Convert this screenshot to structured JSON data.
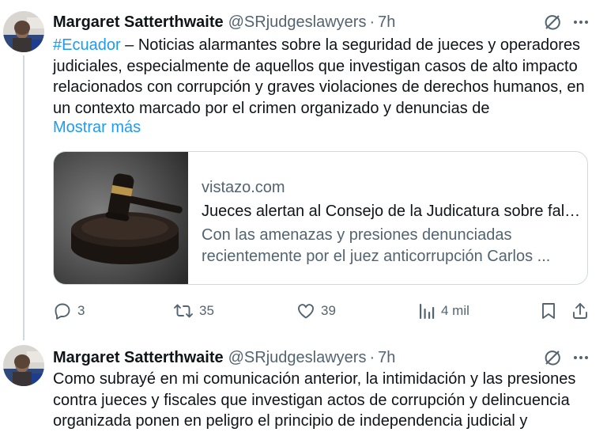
{
  "tweets": [
    {
      "author": "Margaret Satterthwaite",
      "handle": "@SRjudgeslawyers",
      "separator": "·",
      "time": "7h",
      "hashtag": "#Ecuador",
      "text": " – Noticias alarmantes sobre la seguridad de jueces y operadores judiciales, especialmente de aquellos que investigan casos de alto impacto relacionados con corrupción y graves violaciones de derechos humanos, en un contexto marcado por el crimen organizado y denuncias de",
      "show_more": "Mostrar más",
      "card": {
        "domain": "vistazo.com",
        "title": "Jueces alertan al Consejo de la Judicatura sobre falta de seguridad",
        "description_line1": "Con las amenazas y presiones denunciadas",
        "description_line2": "recientemente por el juez anticorrupción Carlos ..."
      },
      "actions": {
        "replies": "3",
        "reposts": "35",
        "likes": "39",
        "views": "4 mil"
      }
    },
    {
      "author": "Margaret Satterthwaite",
      "handle": "@SRjudgeslawyers",
      "separator": "·",
      "time": "7h",
      "text": "Como subrayé en mi comunicación anterior, la intimidación y las presiones contra jueces y fiscales que investigan actos de corrupción y delincuencia organizada ponen en peligro el principio de independencia judicial y"
    }
  ],
  "icons": {
    "reply": "comment-icon",
    "repost": "repost-icon",
    "like": "heart-icon",
    "views": "analytics-icon",
    "bookmark": "bookmark-icon",
    "share": "share-icon",
    "grok": "grok-icon",
    "more": "more-icon"
  },
  "colors": {
    "accent": "#1d9bf0",
    "secondary_text": "#536471",
    "border": "#cfd9de"
  }
}
